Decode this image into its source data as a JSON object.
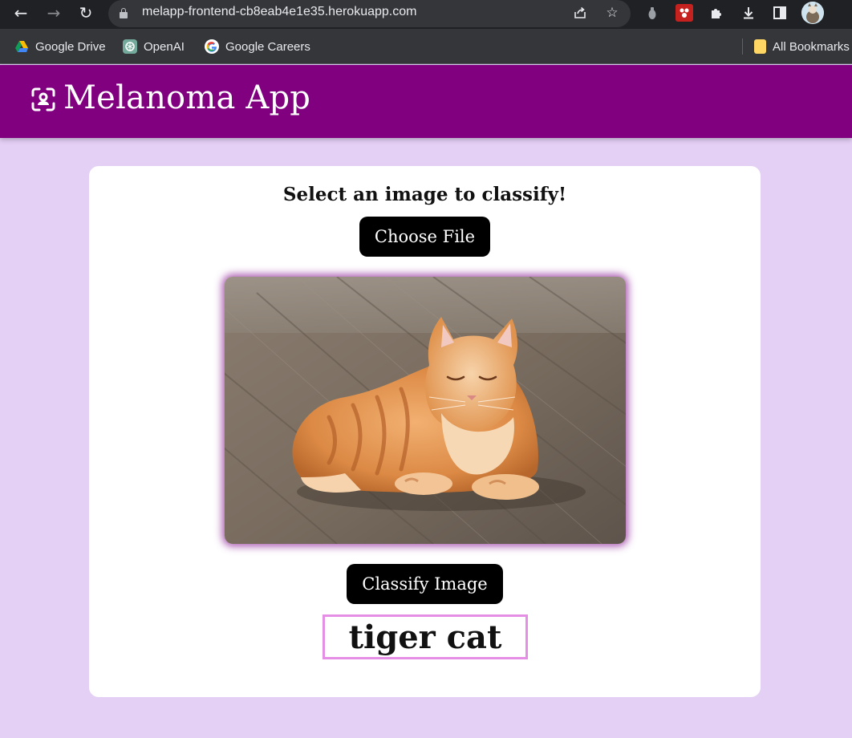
{
  "browser": {
    "url": "melapp-frontend-cb8eab4e1e35.herokuapp.com",
    "icons": {
      "back": "back-arrow-icon",
      "forward": "forward-arrow-icon",
      "reload": "reload-icon",
      "lock": "lock-icon",
      "share": "share-icon",
      "bookmark_star": "star-icon",
      "extensions": "puzzle-icon",
      "download": "download-icon",
      "side_panel": "side-panel-icon",
      "profile": "avatar"
    },
    "bookmarks": [
      {
        "label": "Google Drive",
        "icon": "google-drive-icon"
      },
      {
        "label": "OpenAI",
        "icon": "openai-icon"
      },
      {
        "label": "Google Careers",
        "icon": "google-icon"
      }
    ],
    "all_bookmarks_label": "All Bookmarks"
  },
  "header": {
    "title": "Melanoma App",
    "icon": "face-scan-icon",
    "color": "#800080"
  },
  "main": {
    "heading": "Select an image to classify!",
    "choose_file_label": "Choose File",
    "image": {
      "subject": "orange tabby cat lying on a wooden floor"
    },
    "classify_label": "Classify Image",
    "result": "tiger cat"
  },
  "colors": {
    "page_background": "#e4cff5",
    "card_background": "#ffffff",
    "button_background": "#000000",
    "result_border": "#e58ee5",
    "image_glow": "#8c1e96"
  }
}
